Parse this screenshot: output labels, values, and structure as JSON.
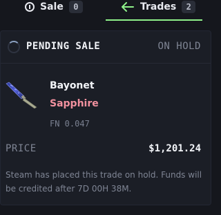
{
  "tabs": [
    {
      "label": "Sale",
      "count": "0",
      "icon": "info-icon"
    },
    {
      "label": "Trades",
      "count": "2",
      "icon": "arrow-left-icon"
    }
  ],
  "active_tab": "Trades",
  "colors": {
    "accent": "#8ff18a",
    "skin": "#f2919f",
    "muted": "#7f8594",
    "background": "#15171d",
    "card": "#1b1e26"
  },
  "trade": {
    "header": "PENDING SALE",
    "status": "ON HOLD",
    "item": {
      "name": "Bayonet",
      "skin": "Sapphire",
      "wear": "FN 0.047",
      "icon": "knife-icon"
    },
    "price_label": "PRICE",
    "price": "$1,201.24",
    "note": "Steam has placed this trade on hold. Funds will be credited after 7D 00H 38M."
  }
}
